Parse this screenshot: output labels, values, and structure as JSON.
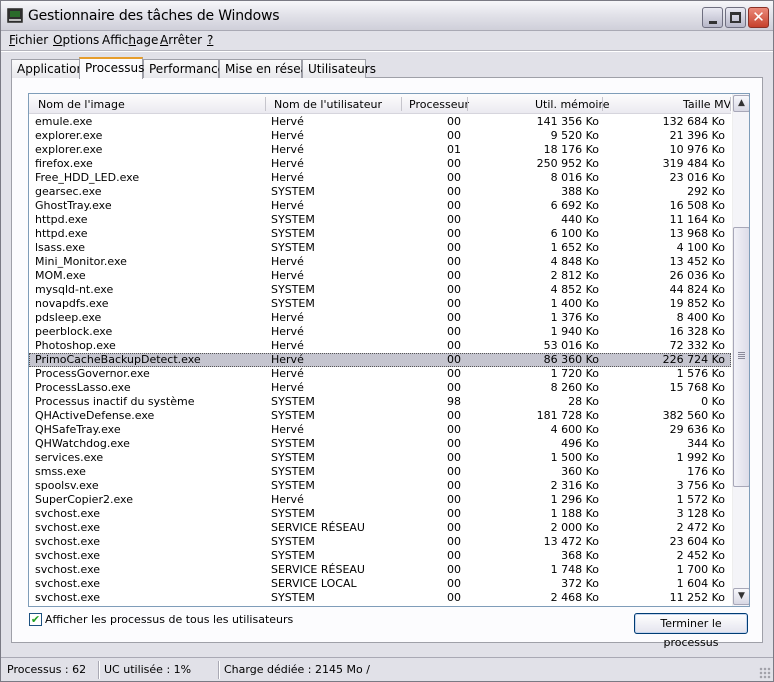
{
  "window": {
    "title": "Gestionnaire des tâches de Windows",
    "controls": {
      "minimize": "minimize",
      "maximize": "maximize",
      "close": "close"
    }
  },
  "menu": [
    {
      "label": "Fichier",
      "accel": "F"
    },
    {
      "label": "Options",
      "accel": "O"
    },
    {
      "label": "Affichage",
      "accel": "h"
    },
    {
      "label": "Arrêter",
      "accel": "A"
    },
    {
      "label": "?",
      "accel": "?"
    }
  ],
  "tabs": [
    {
      "label": "Applications",
      "active": false
    },
    {
      "label": "Processus",
      "active": true
    },
    {
      "label": "Performances",
      "active": false
    },
    {
      "label": "Mise en réseau",
      "active": false
    },
    {
      "label": "Utilisateurs",
      "active": false
    }
  ],
  "table": {
    "columns": [
      "Nom de l'image",
      "Nom de l'utilisateur",
      "Processeur",
      "Util. mémoire",
      "Taille MV"
    ],
    "selected_index": 17,
    "rows": [
      [
        "emule.exe",
        "Hervé",
        "00",
        "141 356 Ko",
        "132 684 Ko"
      ],
      [
        "explorer.exe",
        "Hervé",
        "00",
        "9 520 Ko",
        "21 396 Ko"
      ],
      [
        "explorer.exe",
        "Hervé",
        "01",
        "18 176 Ko",
        "10 976 Ko"
      ],
      [
        "firefox.exe",
        "Hervé",
        "00",
        "250 952 Ko",
        "319 484 Ko"
      ],
      [
        "Free_HDD_LED.exe",
        "Hervé",
        "00",
        "8 016 Ko",
        "23 016 Ko"
      ],
      [
        "gearsec.exe",
        "SYSTEM",
        "00",
        "388 Ko",
        "292 Ko"
      ],
      [
        "GhostTray.exe",
        "Hervé",
        "00",
        "6 692 Ko",
        "16 508 Ko"
      ],
      [
        "httpd.exe",
        "SYSTEM",
        "00",
        "440 Ko",
        "11 164 Ko"
      ],
      [
        "httpd.exe",
        "SYSTEM",
        "00",
        "6 100 Ko",
        "13 968 Ko"
      ],
      [
        "lsass.exe",
        "SYSTEM",
        "00",
        "1 652 Ko",
        "4 100 Ko"
      ],
      [
        "Mini_Monitor.exe",
        "Hervé",
        "00",
        "4 848 Ko",
        "13 452 Ko"
      ],
      [
        "MOM.exe",
        "Hervé",
        "00",
        "2 812 Ko",
        "26 036 Ko"
      ],
      [
        "mysqld-nt.exe",
        "SYSTEM",
        "00",
        "4 852 Ko",
        "44 824 Ko"
      ],
      [
        "novapdfs.exe",
        "SYSTEM",
        "00",
        "1 400 Ko",
        "19 852 Ko"
      ],
      [
        "pdsleep.exe",
        "Hervé",
        "00",
        "1 376 Ko",
        "8 400 Ko"
      ],
      [
        "peerblock.exe",
        "Hervé",
        "00",
        "1 940 Ko",
        "16 328 Ko"
      ],
      [
        "Photoshop.exe",
        "Hervé",
        "00",
        "53 016 Ko",
        "72 332 Ko"
      ],
      [
        "PrimoCacheBackupDetect.exe",
        "Hervé",
        "00",
        "86 360 Ko",
        "226 724 Ko"
      ],
      [
        "ProcessGovernor.exe",
        "Hervé",
        "00",
        "1 720 Ko",
        "1 576 Ko"
      ],
      [
        "ProcessLasso.exe",
        "Hervé",
        "00",
        "8 260 Ko",
        "15 768 Ko"
      ],
      [
        "Processus inactif du système",
        "SYSTEM",
        "98",
        "28 Ko",
        "0 Ko"
      ],
      [
        "QHActiveDefense.exe",
        "SYSTEM",
        "00",
        "181 728 Ko",
        "382 560 Ko"
      ],
      [
        "QHSafeTray.exe",
        "Hervé",
        "00",
        "4 600 Ko",
        "29 636 Ko"
      ],
      [
        "QHWatchdog.exe",
        "SYSTEM",
        "00",
        "496 Ko",
        "344 Ko"
      ],
      [
        "services.exe",
        "SYSTEM",
        "00",
        "1 500 Ko",
        "1 992 Ko"
      ],
      [
        "smss.exe",
        "SYSTEM",
        "00",
        "360 Ko",
        "176 Ko"
      ],
      [
        "spoolsv.exe",
        "SYSTEM",
        "00",
        "2 316 Ko",
        "3 756 Ko"
      ],
      [
        "SuperCopier2.exe",
        "Hervé",
        "00",
        "1 296 Ko",
        "1 572 Ko"
      ],
      [
        "svchost.exe",
        "SYSTEM",
        "00",
        "1 188 Ko",
        "3 128 Ko"
      ],
      [
        "svchost.exe",
        "SERVICE RÉSEAU",
        "00",
        "2 000 Ko",
        "2 472 Ko"
      ],
      [
        "svchost.exe",
        "SYSTEM",
        "00",
        "13 472 Ko",
        "23 604 Ko"
      ],
      [
        "svchost.exe",
        "SYSTEM",
        "00",
        "368 Ko",
        "2 452 Ko"
      ],
      [
        "svchost.exe",
        "SERVICE RÉSEAU",
        "00",
        "1 748 Ko",
        "1 700 Ko"
      ],
      [
        "svchost.exe",
        "SERVICE LOCAL",
        "00",
        "372 Ko",
        "1 604 Ko"
      ],
      [
        "svchost.exe",
        "SYSTEM",
        "00",
        "2 468 Ko",
        "11 252 Ko"
      ]
    ]
  },
  "scrollbar": {
    "up_icon": "▲",
    "down_icon": "▼"
  },
  "show_all_users": {
    "label": "Afficher les processus de tous les utilisateurs",
    "checked": true,
    "check_glyph": "✔"
  },
  "end_process_button": {
    "label": "Terminer le processus"
  },
  "status": {
    "processes": "Processus : 62",
    "cpu": "UC utilisée : 1%",
    "commit": "Charge dédiée : 2145 Mo /"
  }
}
